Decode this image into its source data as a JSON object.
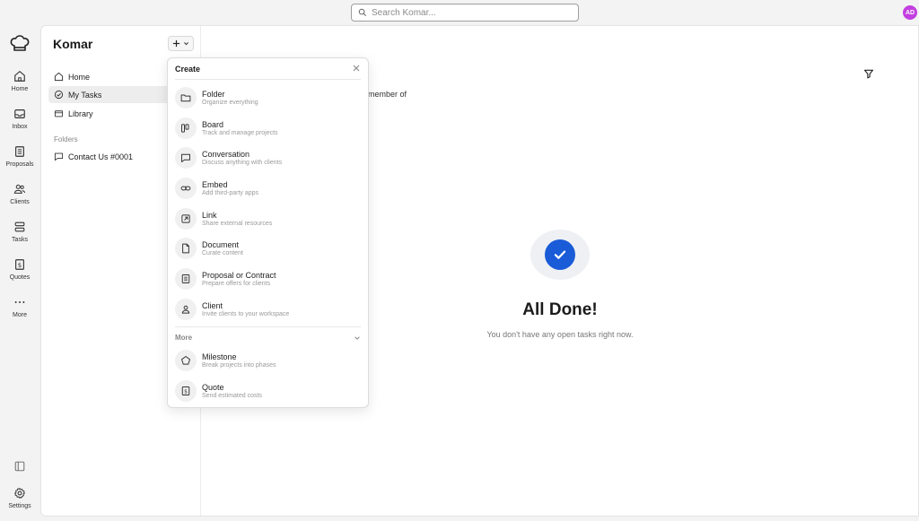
{
  "topbar": {
    "search_placeholder": "Search Komar...",
    "avatar_initials": "AD",
    "avatar_color": "#c23fe0"
  },
  "rail": {
    "items": [
      {
        "label": "Home",
        "icon": "home-icon"
      },
      {
        "label": "Inbox",
        "icon": "inbox-icon"
      },
      {
        "label": "Proposals",
        "icon": "proposal-icon"
      },
      {
        "label": "Clients",
        "icon": "clients-icon"
      },
      {
        "label": "Tasks",
        "icon": "tasks-icon"
      },
      {
        "label": "Quotes",
        "icon": "quotes-icon"
      },
      {
        "label": "More",
        "icon": "more-icon"
      }
    ],
    "settings_label": "Settings"
  },
  "sidebar": {
    "workspace_title": "Komar",
    "nav": [
      {
        "label": "Home",
        "icon": "home-icon"
      },
      {
        "label": "My Tasks",
        "icon": "check-circle-icon"
      },
      {
        "label": "Library",
        "icon": "library-icon"
      }
    ],
    "folders_label": "Folders",
    "folders": [
      {
        "label": "Contact Us #0001",
        "icon": "conversation-icon"
      }
    ]
  },
  "main": {
    "member_text": "member of",
    "done_title": "All Done!",
    "done_subtitle": "You don't have any open tasks right now.",
    "accent_color": "#1a5bd8"
  },
  "create_popup": {
    "title": "Create",
    "items": [
      {
        "title": "Folder",
        "subtitle": "Organize everything",
        "icon": "folder-icon"
      },
      {
        "title": "Board",
        "subtitle": "Track and manage projects",
        "icon": "board-icon"
      },
      {
        "title": "Conversation",
        "subtitle": "Discuss anything with clients",
        "icon": "conversation-icon"
      },
      {
        "title": "Embed",
        "subtitle": "Add third-party apps",
        "icon": "link-chain-icon"
      },
      {
        "title": "Link",
        "subtitle": "Share external resources",
        "icon": "external-link-icon"
      },
      {
        "title": "Document",
        "subtitle": "Curate content",
        "icon": "document-icon"
      },
      {
        "title": "Proposal or Contract",
        "subtitle": "Prepare offers for clients",
        "icon": "proposal-icon"
      },
      {
        "title": "Client",
        "subtitle": "Invite clients to your workspace",
        "icon": "client-icon"
      }
    ],
    "more_label": "More",
    "more_items": [
      {
        "title": "Milestone",
        "subtitle": "Break projects into phases",
        "icon": "pentagon-icon"
      },
      {
        "title": "Quote",
        "subtitle": "Send estimated costs",
        "icon": "quote-dollar-icon"
      }
    ]
  }
}
